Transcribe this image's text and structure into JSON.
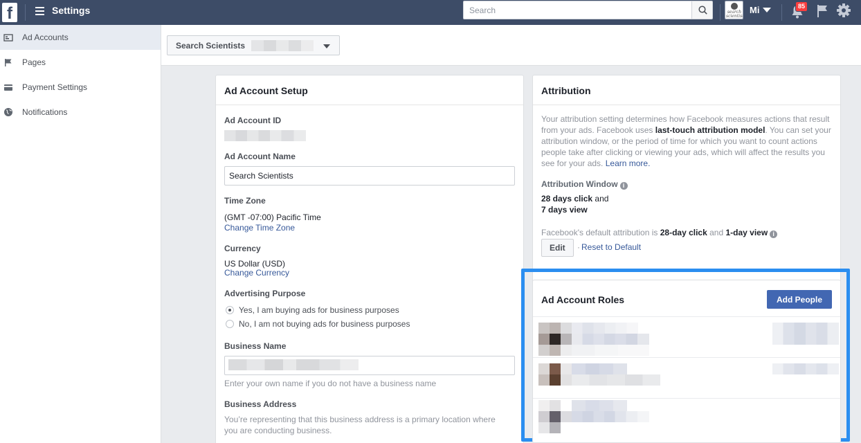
{
  "topbar": {
    "logo": "f",
    "title": "Settings",
    "search_placeholder": "Search",
    "user_name": "Mi",
    "avatar_text": "search scientists",
    "notification_count": "85",
    "icons": [
      "facebook-logo-icon",
      "menu-icon",
      "search-icon",
      "chevron-down-icon",
      "notifications-icon",
      "flag-icon",
      "gear-icon"
    ]
  },
  "sidebar": {
    "items": [
      {
        "label": "Ad Accounts",
        "icon": "ad-accounts-icon",
        "active": true
      },
      {
        "label": "Pages",
        "icon": "flag-icon",
        "active": false
      },
      {
        "label": "Payment Settings",
        "icon": "credit-card-icon",
        "active": false
      },
      {
        "label": "Notifications",
        "icon": "globe-icon",
        "active": false
      }
    ]
  },
  "account_selector": {
    "label": "Search Scientists"
  },
  "setup": {
    "title": "Ad Account Setup",
    "ad_account_id_label": "Ad Account ID",
    "ad_account_name_label": "Ad Account Name",
    "ad_account_name_value": "Search Scientists",
    "time_zone_label": "Time Zone",
    "time_zone_value": "(GMT -07:00) Pacific Time",
    "change_time_zone": "Change Time Zone",
    "currency_label": "Currency",
    "currency_value": "US Dollar (USD)",
    "change_currency": "Change Currency",
    "advertising_purpose_label": "Advertising Purpose",
    "purpose_yes": "Yes, I am buying ads for business purposes",
    "purpose_no": "No, I am not buying ads for business purposes",
    "business_name_label": "Business Name",
    "business_name_help": "Enter your own name if you do not have a business name",
    "business_address_label": "Business Address",
    "business_address_help_1": "You’re representing that this business address is a primary location where",
    "business_address_help_2": "you are conducting business."
  },
  "attribution": {
    "title": "Attribution",
    "desc_1": "Your attribution setting determines how Facebook measures actions that result from your ads. Facebook uses ",
    "desc_bold": "last-touch attribution model",
    "desc_2": ". You can set your attribution window, or the period of time for which you want to count actions people take after clicking or viewing your ads, which will affect the results you see for your ads. ",
    "learn_more": "Learn more.",
    "window_label": "Attribution Window",
    "window_click_bold": "28 days click",
    "window_and": " and",
    "window_view_bold": "7 days view",
    "default_prefix": "Facebook's default attribution is ",
    "default_click": "28-day click",
    "default_and": " and ",
    "default_view": "1-day view",
    "edit_button": "Edit",
    "separator": "·",
    "reset_link": "Reset to Default"
  },
  "roles": {
    "title": "Ad Account Roles",
    "add_people_button": "Add People"
  }
}
